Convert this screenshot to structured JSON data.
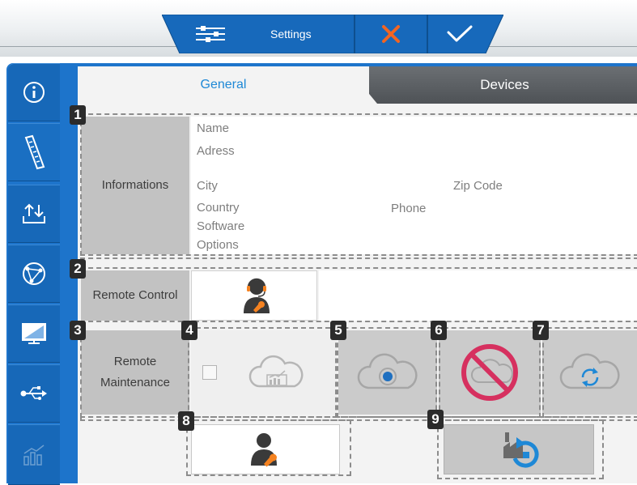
{
  "toolbar": {
    "settings_label": "Settings",
    "settings_icon": "sliders-icon",
    "cancel_icon": "close-icon",
    "confirm_icon": "check-icon"
  },
  "sidebar": {
    "items": [
      {
        "icon": "info-icon"
      },
      {
        "icon": "ruler-icon"
      },
      {
        "icon": "transfer-icon"
      },
      {
        "icon": "network-icon"
      },
      {
        "icon": "monitor-icon"
      },
      {
        "icon": "usb-icon"
      },
      {
        "icon": "chart-icon"
      }
    ]
  },
  "tabs": {
    "general": "General",
    "devices": "Devices"
  },
  "informations": {
    "label": "Informations",
    "name": "Name",
    "adress": "Adress",
    "city": "City",
    "zip_code": "Zip Code",
    "country": "Country",
    "phone": "Phone",
    "software": "Software",
    "options": "Options"
  },
  "remote_control": {
    "label": "Remote Control"
  },
  "remote_maintenance": {
    "label_line1": "Remote",
    "label_line2": "Maintenance"
  },
  "badges": [
    "1",
    "2",
    "3",
    "4",
    "5",
    "6",
    "7",
    "8",
    "9"
  ],
  "colors": {
    "accent": "#1d74cb",
    "tab_active_text": "#1e88d6",
    "cancel": "#f26522",
    "forbidden": "#d6305f"
  }
}
